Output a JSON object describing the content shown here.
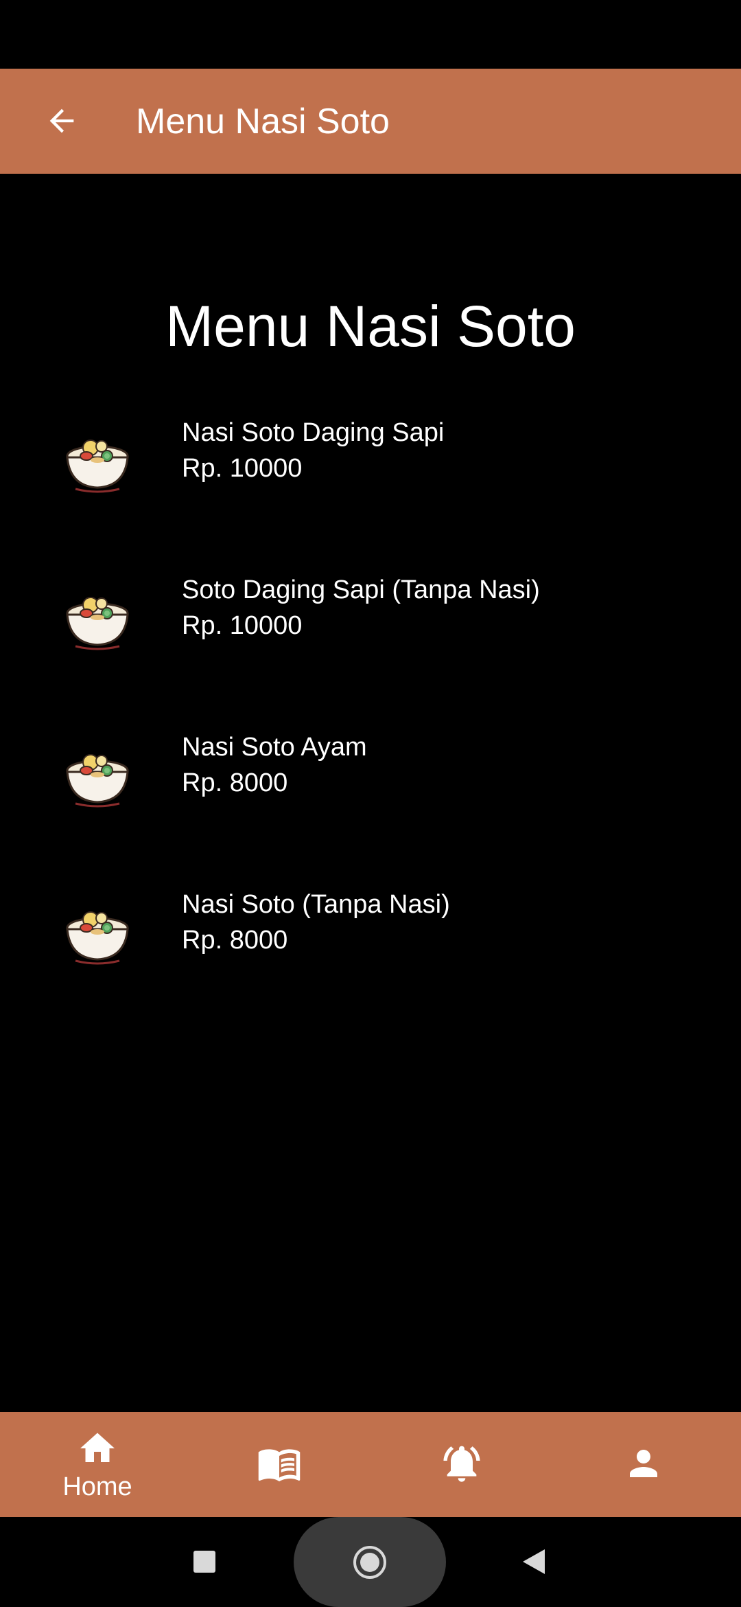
{
  "app_bar": {
    "title": "Menu Nasi Soto"
  },
  "page": {
    "heading": "Menu Nasi Soto"
  },
  "menu_items": [
    {
      "name": "Nasi Soto Daging Sapi",
      "price": "Rp. 10000",
      "icon": "soto-bowl-icon"
    },
    {
      "name": "Soto Daging Sapi (Tanpa Nasi)",
      "price": "Rp. 10000",
      "icon": "soto-bowl-icon"
    },
    {
      "name": "Nasi Soto Ayam",
      "price": "Rp. 8000",
      "icon": "soto-bowl-icon"
    },
    {
      "name": "Nasi Soto (Tanpa Nasi)",
      "price": "Rp. 8000",
      "icon": "soto-bowl-icon"
    }
  ],
  "bottom_nav": {
    "items": [
      {
        "label": "Home",
        "icon": "home-icon",
        "active": true
      },
      {
        "label": "",
        "icon": "menu-book-icon",
        "active": false
      },
      {
        "label": "",
        "icon": "notification-bell-icon",
        "active": false
      },
      {
        "label": "",
        "icon": "profile-icon",
        "active": false
      }
    ]
  },
  "colors": {
    "accent": "#c1714d",
    "background": "#000000",
    "text": "#ffffff"
  }
}
